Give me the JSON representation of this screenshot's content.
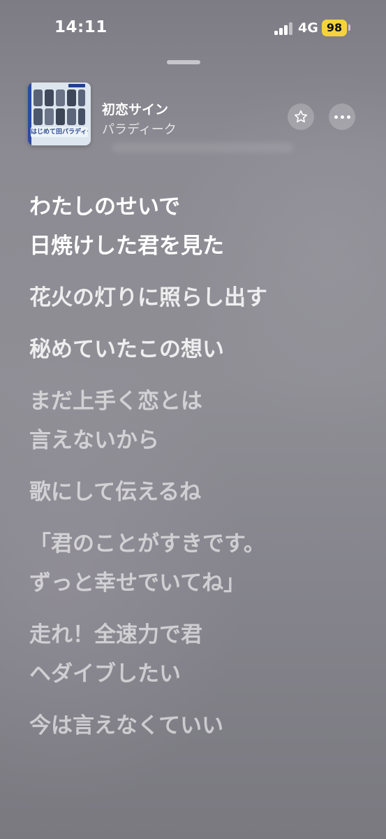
{
  "status_bar": {
    "time": "14:11",
    "network": "4G",
    "battery": "98"
  },
  "player": {
    "artwork_text": "はじめて田パラディーク",
    "song_title": "初恋サイン",
    "artist": "パラディーク"
  },
  "icons": {
    "star": "star-icon",
    "more": "ellipsis-icon",
    "signal": "signal-icon"
  },
  "lyrics": [
    {
      "text": "わたしのせいで\n日焼けした君を見た",
      "state": "active"
    },
    {
      "text": "花火の灯りに照らし出す",
      "state": "next"
    },
    {
      "text": "秘めていたこの想い",
      "state": "next"
    },
    {
      "text": "まだ上手く恋とは\n言えないから",
      "state": "dim"
    },
    {
      "text": "歌にして伝えるね",
      "state": "dim"
    },
    {
      "text": "「君のことがすきです。\nずっと幸せでいてね」",
      "state": "dim"
    },
    {
      "text": "走れ！全速力で君\nヘダイブしたい",
      "state": "dim"
    },
    {
      "text": "今は言えなくていい",
      "state": "dim"
    }
  ],
  "colors": {
    "battery": "#f5d33b",
    "background": "#8c8a92"
  }
}
